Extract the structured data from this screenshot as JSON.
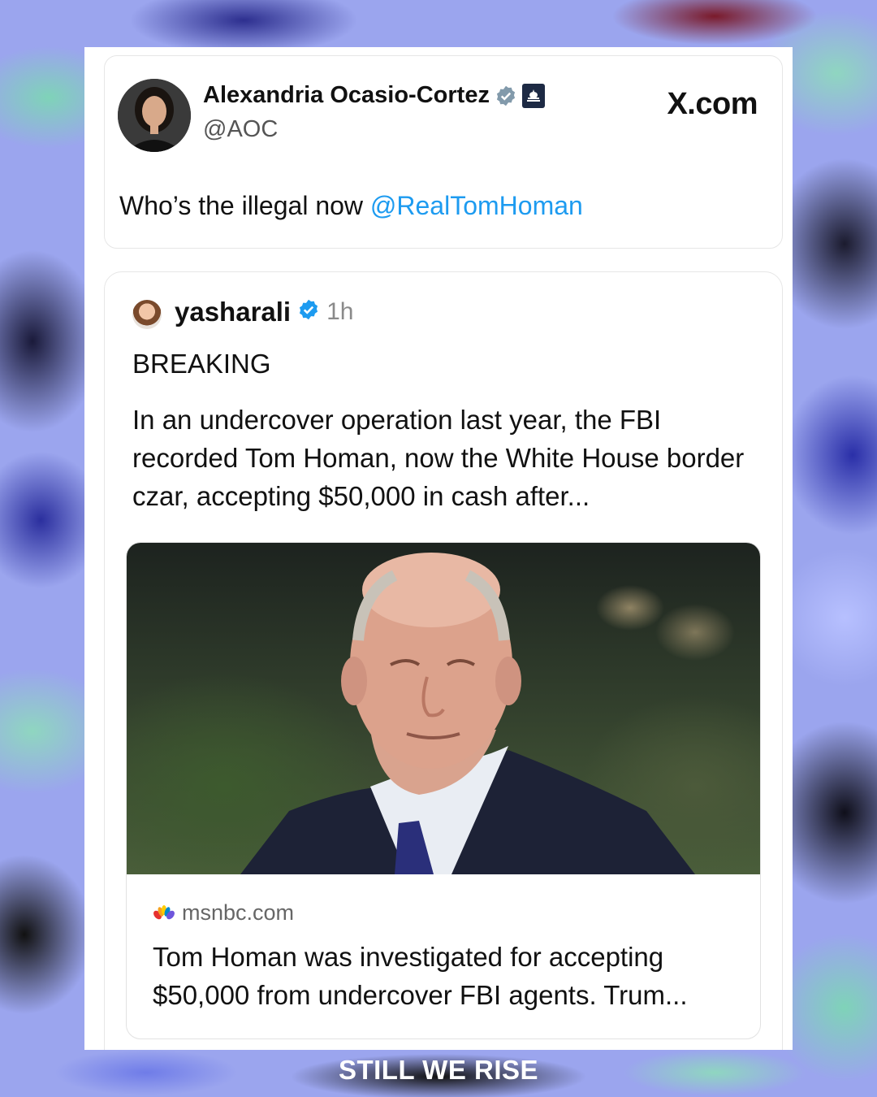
{
  "tweet": {
    "author_name": "Alexandria Ocasio-Cortez",
    "handle": "@AOC",
    "site": "X.com",
    "text_prefix": "Who’s the illegal now ",
    "mention": "@RealTomHoman"
  },
  "quote": {
    "author": "yasharali",
    "time": "1h",
    "label": "BREAKING",
    "body": "In an undercover operation last year, the FBI recorded Tom Homan, now the White House border czar, accepting $50,000 in cash after...",
    "link": {
      "domain": "msnbc.com",
      "title": "Tom Homan was investigated for accepting $50,000 from undercover FBI agents. Trum..."
    }
  },
  "footer": {
    "brand": "STILL WE RISE"
  },
  "colors": {
    "mention": "#1d9bf0",
    "verified": "#1d9bf0",
    "gov_badge": "#829aab"
  },
  "icons": [
    "gray-verified-icon",
    "capitol-badge-icon",
    "blue-verified-icon",
    "nbc-peacock-icon"
  ]
}
